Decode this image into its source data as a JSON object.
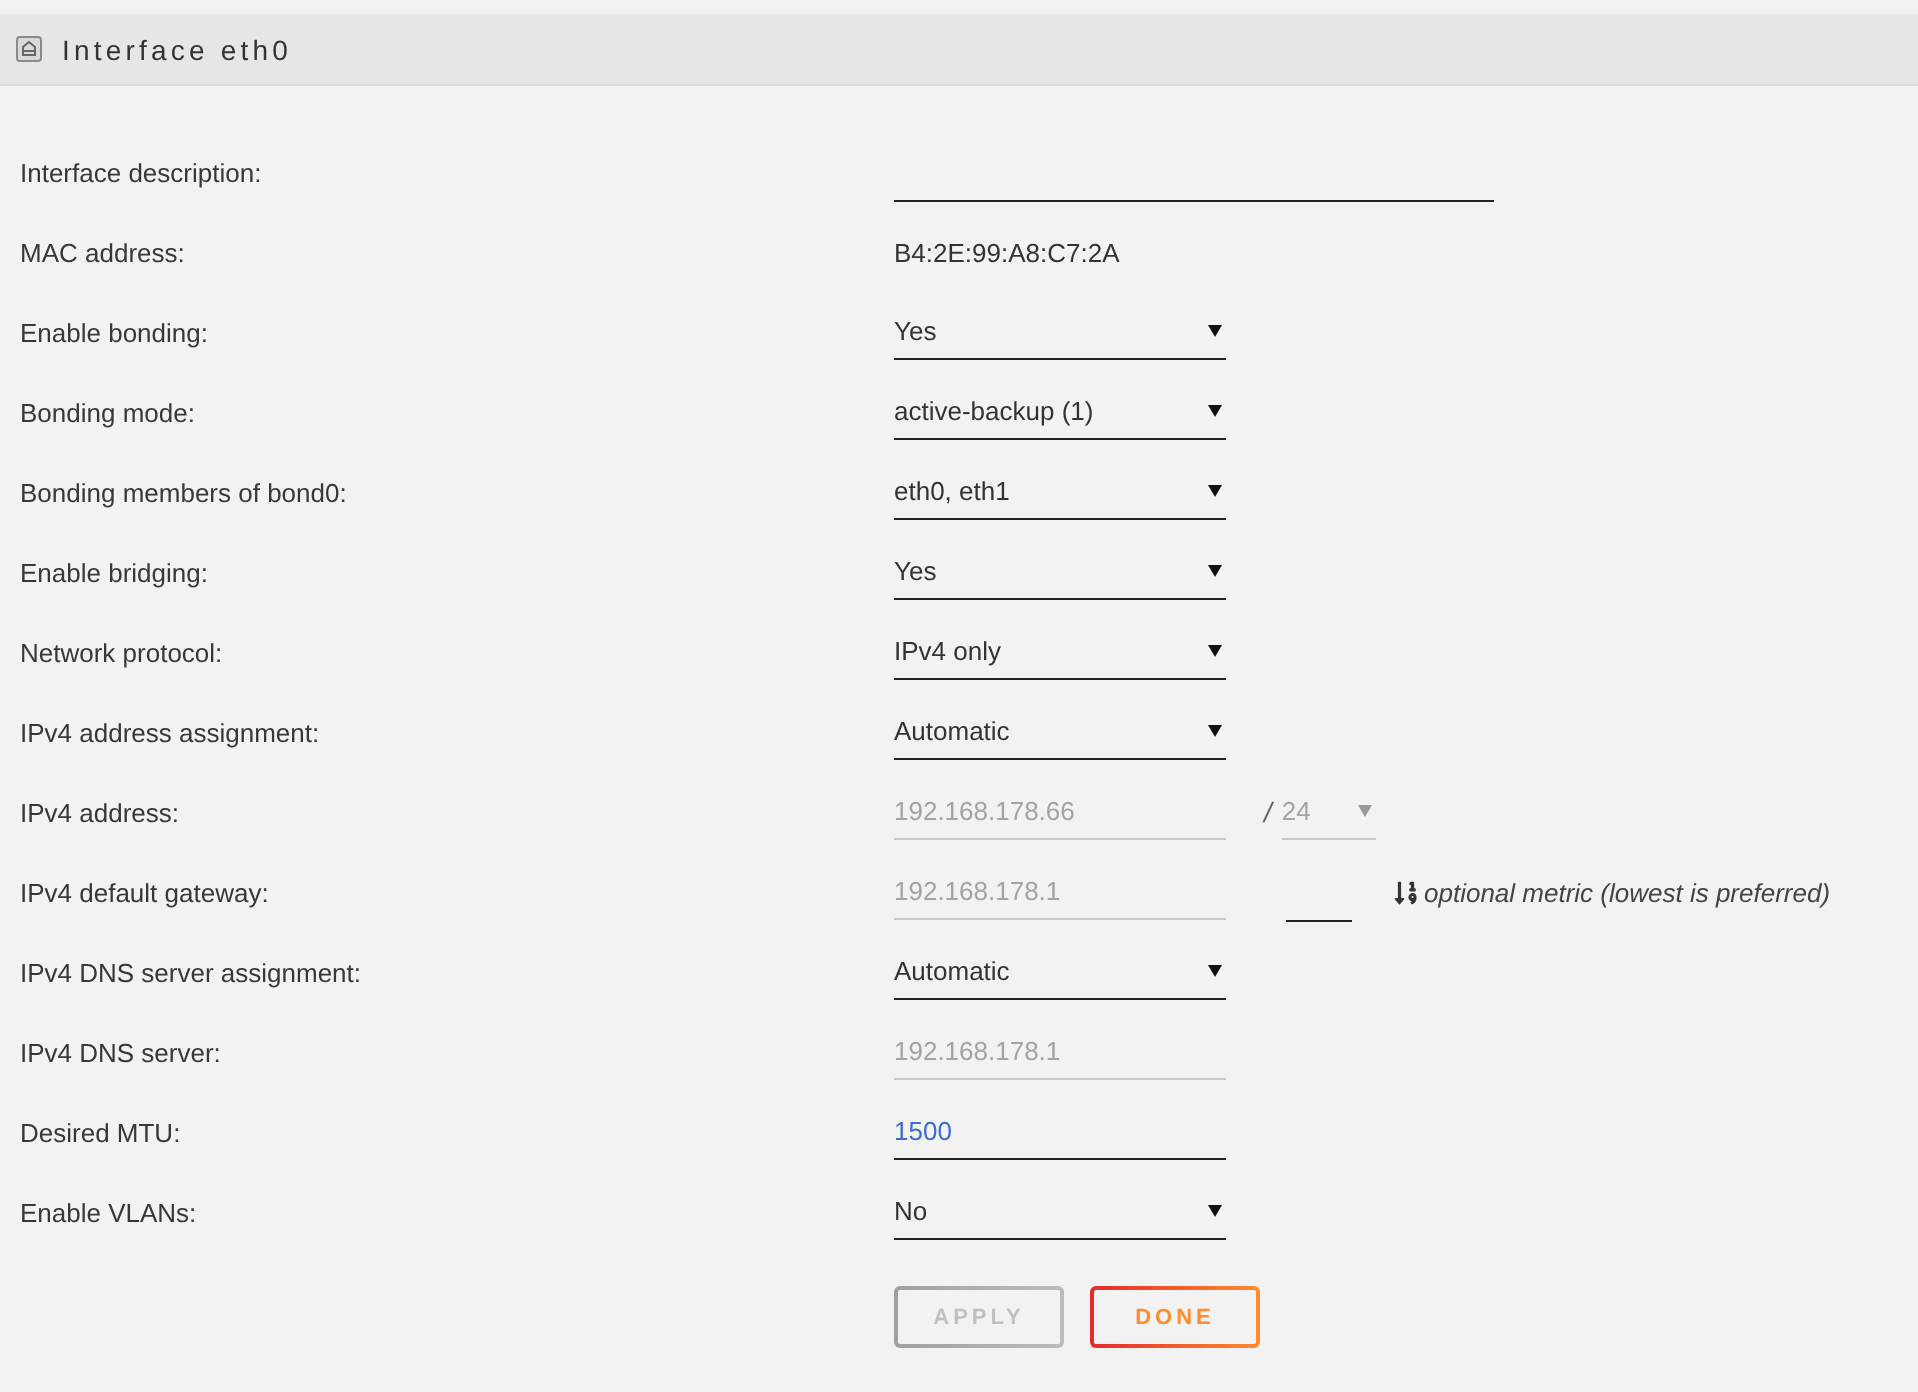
{
  "panel": {
    "title": "Interface eth0"
  },
  "fields": [
    {
      "kind": "textbox",
      "label": "Interface description:",
      "disabled": false
    },
    {
      "kind": "static",
      "label": "MAC address:",
      "value": "B4:2E:99:A8:C7:2A"
    },
    {
      "kind": "select",
      "label": "Enable bonding:",
      "value": "Yes",
      "disabled": false
    },
    {
      "kind": "select",
      "label": "Bonding mode:",
      "value": "active-backup (1)",
      "disabled": false
    },
    {
      "kind": "select",
      "label": "Bonding members of bond0:",
      "value": "eth0, eth1",
      "disabled": false
    },
    {
      "kind": "select",
      "label": "Enable bridging:",
      "value": "Yes",
      "disabled": false
    },
    {
      "kind": "select",
      "label": "Network protocol:",
      "value": "IPv4 only",
      "disabled": false
    },
    {
      "kind": "select",
      "label": "IPv4 address assignment:",
      "value": "Automatic",
      "disabled": false
    },
    {
      "kind": "input",
      "label": "IPv4 address:",
      "value": "192.168.178.66",
      "disabled": true,
      "prefix": {
        "separator": "/",
        "value": "24",
        "disabled": true
      }
    },
    {
      "kind": "input",
      "label": "IPv4 default gateway:",
      "value": "192.168.178.1",
      "disabled": true,
      "metric": {
        "hint": "optional metric (lowest is preferred)",
        "disabled": false
      }
    },
    {
      "kind": "select",
      "label": "IPv4 DNS server assignment:",
      "value": "Automatic",
      "disabled": false
    },
    {
      "kind": "input",
      "label": "IPv4 DNS server:",
      "value": "192.168.178.1",
      "disabled": true
    },
    {
      "kind": "input",
      "label": "Desired MTU:",
      "value": "1500",
      "disabled": false
    },
    {
      "kind": "select",
      "label": "Enable VLANs:",
      "value": "No",
      "disabled": false
    }
  ],
  "buttons": [
    {
      "label": "APPLY",
      "disabled": true
    },
    {
      "label": "DONE",
      "disabled": false
    }
  ]
}
